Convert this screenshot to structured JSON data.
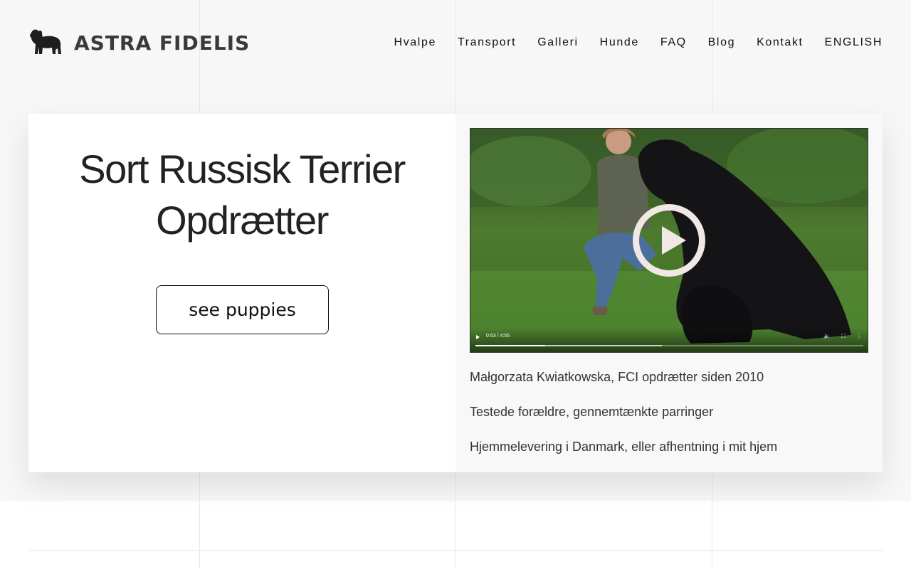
{
  "header": {
    "brand": "ASTRA FIDELIS",
    "logo_icon": "dog-icon",
    "nav": [
      "Hvalpe",
      "Transport",
      "Galleri",
      "Hunde",
      "FAQ",
      "Blog",
      "Kontakt",
      "ENGLISH"
    ]
  },
  "hero": {
    "title": "Sort Russisk Terrier Opdrætter",
    "cta_label": "see puppies"
  },
  "video": {
    "current_time": "0:53",
    "duration": "4:55",
    "time_display": "0:53 / 4:55",
    "played_fraction": 0.18,
    "buffered_fraction": 0.48
  },
  "info": {
    "line1": "Małgorzata Kwiatkowska, FCI opdrætter siden 2010",
    "line2": "Testede forældre, gennemtænkte parringer",
    "line3": "Hjemmelevering i Danmark, eller afhentning i mit hjem"
  },
  "colors": {
    "page_band": "#f7f7f7",
    "text": "#222222",
    "play_ring": "#f1e7e5"
  }
}
